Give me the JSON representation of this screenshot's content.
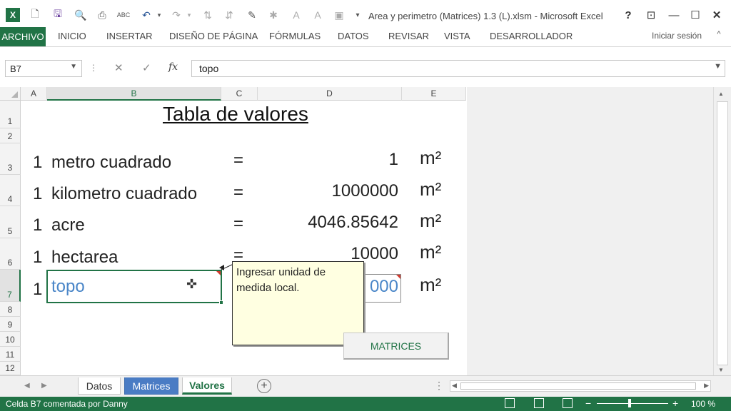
{
  "window": {
    "title": "Area y perimetro (Matrices) 1.3 (L).xlsm - Microsoft Excel",
    "help": "?",
    "restore_ribbon": "⊡",
    "minimize": "—",
    "maximize": "☐",
    "close": "✕"
  },
  "quick_access": {
    "excel_logo": "X",
    "icons": [
      "new-document-icon",
      "save-icon",
      "print-preview-icon",
      "print-icon",
      "spelling-icon",
      "undo-icon",
      "redo-icon",
      "sort-ascending-icon",
      "sort-descending-icon",
      "format-painter-icon",
      "font-icon",
      "insert-image-icon",
      "customize-icon"
    ]
  },
  "ribbon": {
    "file_tab": "ARCHIVO",
    "tabs": [
      "INICIO",
      "INSERTAR",
      "DISEÑO DE PÁGINA",
      "FÓRMULAS",
      "DATOS",
      "REVISAR",
      "VISTA",
      "DESARROLLADOR"
    ],
    "sign_in": "Iniciar sesión",
    "collapse": "^"
  },
  "formula_bar": {
    "name_box": "B7",
    "cancel": "✕",
    "enter": "✓",
    "fx": "fx",
    "value": "topo"
  },
  "grid": {
    "columns": [
      "A",
      "B",
      "C",
      "D",
      "E"
    ],
    "selected_column": "B",
    "rows": [
      "1",
      "2",
      "3",
      "4",
      "5",
      "6",
      "7",
      "8",
      "9",
      "10",
      "11",
      "12"
    ],
    "selected_row": "7",
    "title": "Tabla de valores",
    "table": [
      {
        "qty": "1",
        "unit": "metro cuadrado",
        "eq": "=",
        "value": "1",
        "result_unit": "m²"
      },
      {
        "qty": "1",
        "unit": "kilometro cuadrado",
        "eq": "=",
        "value": "1000000",
        "result_unit": "m²"
      },
      {
        "qty": "1",
        "unit": "acre",
        "eq": "=",
        "value": "4046.85642",
        "result_unit": "m²"
      },
      {
        "qty": "1",
        "unit": "hectarea",
        "eq": "=",
        "value": "10000",
        "result_unit": "m²"
      },
      {
        "qty": "1",
        "unit": "topo",
        "eq": "",
        "value": "000",
        "result_unit": "m²"
      }
    ],
    "active_cell_color": "#217346",
    "input_text_color": "#4a86c8"
  },
  "comment": {
    "text": "Ingresar unidad de medida local."
  },
  "button": {
    "label": "MATRICES"
  },
  "sheets": {
    "tabs": [
      "Datos",
      "Matrices",
      "Valores"
    ],
    "active": "Valores",
    "add": "+"
  },
  "status": {
    "text": "Celda B7 comentada por Danny",
    "zoom": "100 %",
    "zoom_percent": 100,
    "color": "#217346"
  }
}
